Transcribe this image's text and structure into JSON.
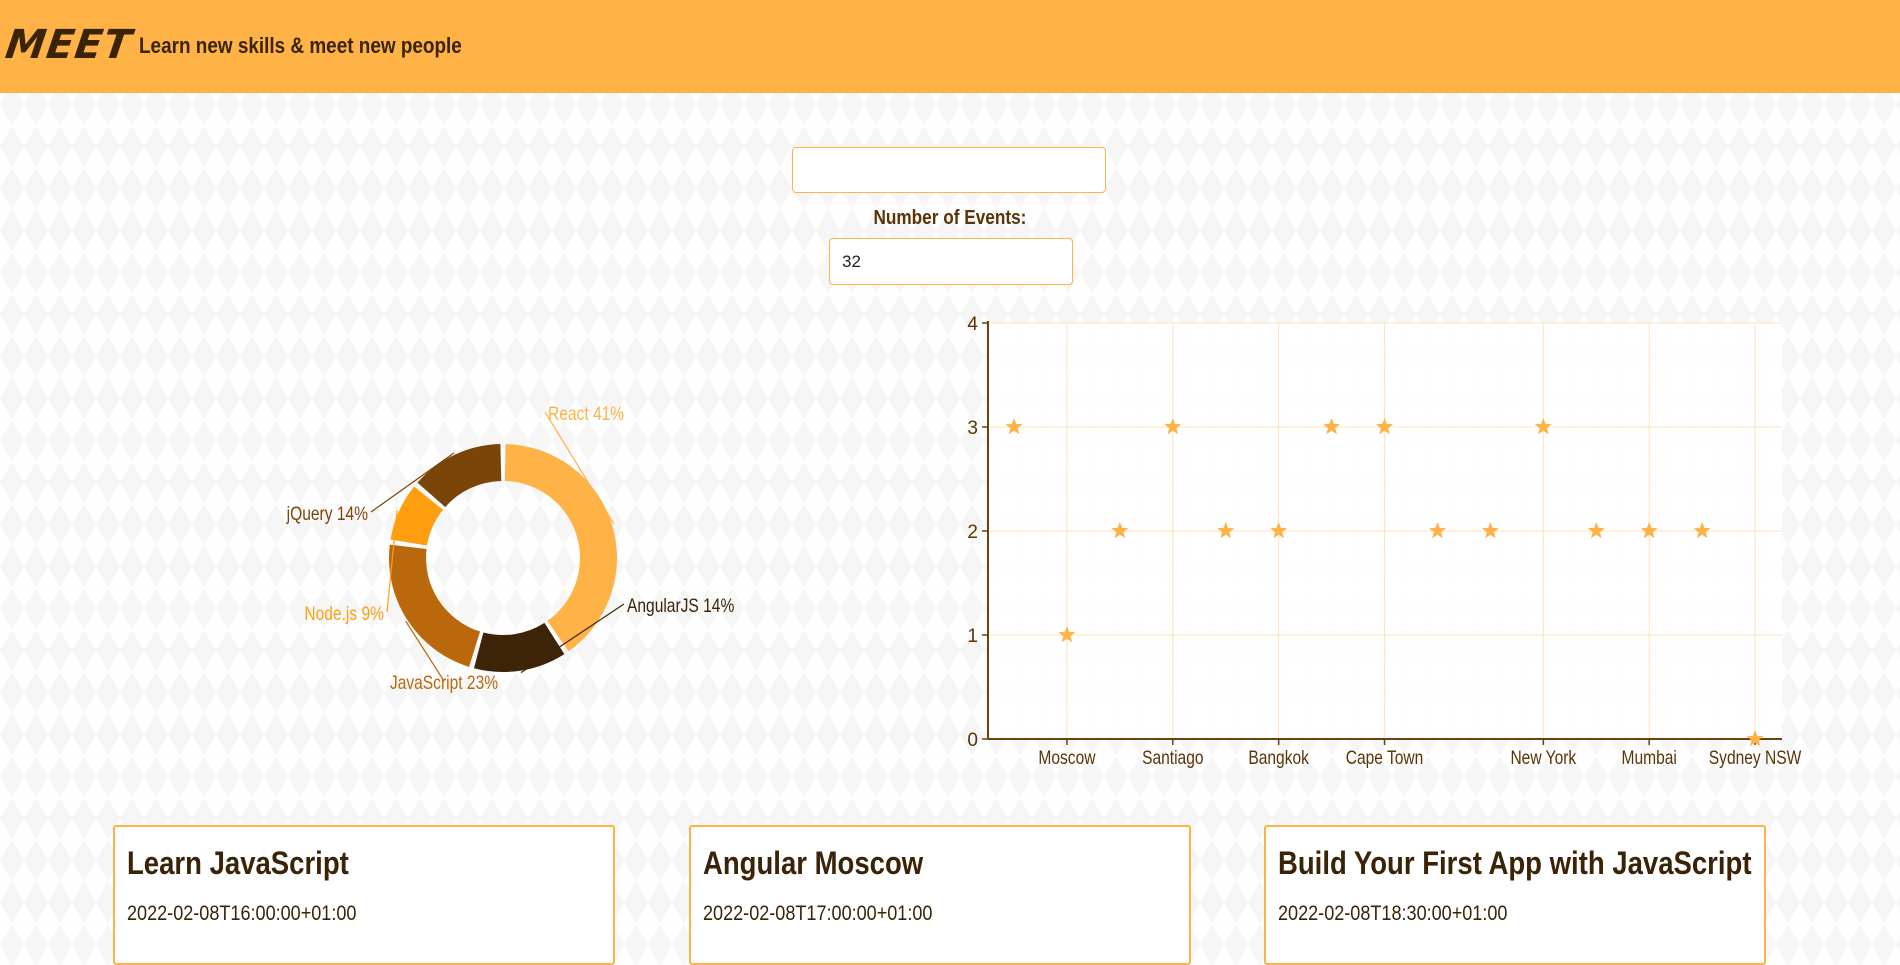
{
  "header": {
    "logo": "MEET",
    "tagline": "Learn new skills & meet new people"
  },
  "search": {
    "city_value": "",
    "city_placeholder": ""
  },
  "number_of_events": {
    "label": "Number of Events:",
    "value": "32"
  },
  "colors": {
    "header_bg": "#ffb347",
    "text_dark": "#3a2306",
    "accent": "#ffb347"
  },
  "chart_data": [
    {
      "type": "pie",
      "variant": "donut",
      "slices": [
        {
          "label": "React 41%",
          "value": 41,
          "color": "#ffb347"
        },
        {
          "label": "AngularJS 14%",
          "value": 14,
          "color": "#3d2409"
        },
        {
          "label": "JavaScript 23%",
          "value": 23,
          "color": "#b9680b"
        },
        {
          "label": "Node.js 9%",
          "value": 9,
          "color": "#ff9f0f"
        },
        {
          "label": "jQuery 14%",
          "value": 14,
          "color": "#7a4508"
        }
      ]
    },
    {
      "type": "scatter",
      "marker": "star",
      "color": "#ffb347",
      "ylim": [
        0,
        4
      ],
      "yticks": [
        0,
        1,
        2,
        3,
        4
      ],
      "xticks": [
        "Moscow",
        "Santiago",
        "Bangkok",
        "Cape Town",
        "New York",
        "Mumbai",
        "Sydney NSW"
      ],
      "points": [
        {
          "x": 0,
          "y": 3
        },
        {
          "x": 1,
          "y": 1
        },
        {
          "x": 2,
          "y": 2
        },
        {
          "x": 3,
          "y": 3
        },
        {
          "x": 4,
          "y": 2
        },
        {
          "x": 5,
          "y": 2
        },
        {
          "x": 6,
          "y": 3
        },
        {
          "x": 7,
          "y": 3
        },
        {
          "x": 8,
          "y": 2
        },
        {
          "x": 9,
          "y": 2
        },
        {
          "x": 10,
          "y": 3
        },
        {
          "x": 11,
          "y": 2
        },
        {
          "x": 12,
          "y": 2
        },
        {
          "x": 13,
          "y": 2
        },
        {
          "x": 14,
          "y": 0
        }
      ],
      "xtick_positions": [
        1,
        3,
        5,
        7,
        10,
        12,
        14
      ],
      "grid": true
    }
  ],
  "events": [
    {
      "title": "Learn JavaScript",
      "date": "2022-02-08T16:00:00+01:00"
    },
    {
      "title": "Angular Moscow",
      "date": "2022-02-08T17:00:00+01:00"
    },
    {
      "title": "Build Your First App with JavaScript",
      "date": "2022-02-08T18:30:00+01:00"
    }
  ]
}
